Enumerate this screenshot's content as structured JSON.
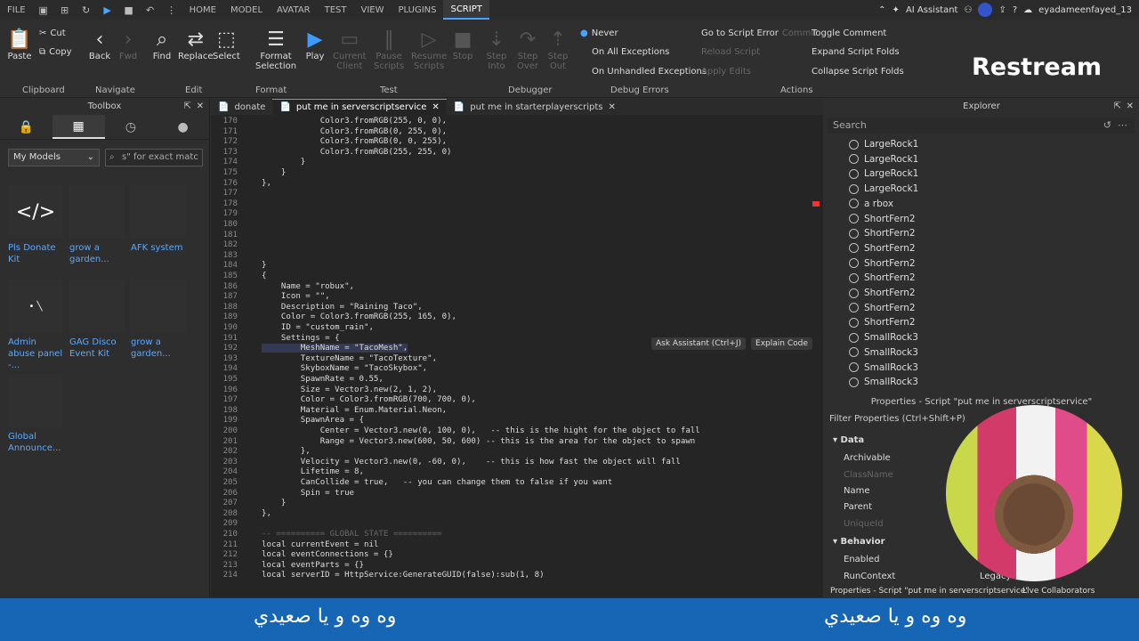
{
  "menu": {
    "file": "FILE",
    "home": "HOME",
    "model": "MODEL",
    "avatar": "AVATAR",
    "test": "TEST",
    "view": "VIEW",
    "plugins": "PLUGINS",
    "script": "SCRIPT",
    "assistant": "AI Assistant",
    "user": "eyadameenfayed_13"
  },
  "ribbon": {
    "cut": "Cut",
    "copy": "Copy",
    "paste": "Paste",
    "back": "Back",
    "fwd": "Fwd",
    "find": "Find",
    "replace": "Replace",
    "select": "Select",
    "format": "Format",
    "selection": "Selection",
    "play": "Play",
    "current": "Current",
    "client": "Client",
    "pause": "Pause",
    "scripts": "Scripts",
    "resume": "Resume",
    "scripts2": "Scripts",
    "stop": "Stop",
    "stepinto1": "Step",
    "stepinto2": "Into",
    "stepover1": "Step",
    "stepover2": "Over",
    "stepout1": "Step",
    "stepout2": "Out",
    "never": "Never",
    "allexc": "On All Exceptions",
    "unhandled": "On Unhandled Exceptions",
    "goto": "Go to Script Error",
    "commit": "Commit",
    "reload": "Reload Script",
    "apply": "Apply Edits",
    "toggle": "Toggle Comment",
    "expand": "Expand Script Folds",
    "collapse": "Collapse Script Folds",
    "g_clip": "Clipboard",
    "g_nav": "Navigate",
    "g_edit": "Edit",
    "g_format": "Format",
    "g_test": "Test",
    "g_debug": "Debugger",
    "g_errors": "Debug Errors",
    "g_actions": "Actions"
  },
  "brand": "Restream",
  "toolbox": {
    "title": "Toolbox",
    "dropdown": "My Models",
    "search": "s\" for exact matc",
    "items": [
      "Pls Donate Kit",
      "grow a garden...",
      "AFK system",
      "Admin abuse panel -...",
      "GAG Disco Event Kit",
      "grow a garden...",
      "Global Announce..."
    ]
  },
  "tabs": [
    "donate",
    "put me in serverscriptservice",
    "put me in starterplayerscripts"
  ],
  "code": [
    [
      "170",
      "            Color3.fromRGB(255, 0, 0),"
    ],
    [
      "171",
      "            Color3.fromRGB(0, 255, 0),"
    ],
    [
      "172",
      "            Color3.fromRGB(0, 0, 255),"
    ],
    [
      "173",
      "            Color3.fromRGB(255, 255, 0)"
    ],
    [
      "174",
      "        }"
    ],
    [
      "175",
      "    }"
    ],
    [
      "176",
      "},"
    ],
    [
      "177",
      ""
    ],
    [
      "178",
      ""
    ],
    [
      "179",
      ""
    ],
    [
      "180",
      ""
    ],
    [
      "181",
      ""
    ],
    [
      "182",
      ""
    ],
    [
      "183",
      ""
    ],
    [
      "184",
      "}"
    ],
    [
      "185",
      "{"
    ],
    [
      "186",
      "    Name = \"robux\","
    ],
    [
      "187",
      "    Icon = \"\","
    ],
    [
      "188",
      "    Description = \"Raining Taco\","
    ],
    [
      "189",
      "    Color = Color3.fromRGB(255, 165, 0),"
    ],
    [
      "190",
      "    ID = \"custom_rain\","
    ],
    [
      "191",
      "    Settings = {"
    ],
    [
      "192",
      "        MeshName = \"TacoMesh\","
    ],
    [
      "193",
      "        TextureName = \"TacoTexture\","
    ],
    [
      "194",
      "        SkyboxName = \"TacoSkybox\","
    ],
    [
      "195",
      "        SpawnRate = 0.55,"
    ],
    [
      "196",
      "        Size = Vector3.new(2, 1, 2),"
    ],
    [
      "197",
      "        Color = Color3.fromRGB(700, 700, 0),"
    ],
    [
      "198",
      "        Material = Enum.Material.Neon,"
    ],
    [
      "199",
      "        SpawnArea = {"
    ],
    [
      "200",
      "            Center = Vector3.new(0, 100, 0),   -- this is the hight for the object to fall"
    ],
    [
      "201",
      "            Range = Vector3.new(600, 50, 600) -- this is the area for the object to spawn"
    ],
    [
      "202",
      "        },"
    ],
    [
      "203",
      "        Velocity = Vector3.new(0, -60, 0),    -- this is how fast the object will fall"
    ],
    [
      "204",
      "        Lifetime = 8,"
    ],
    [
      "205",
      "        CanCollide = true,   -- you can change them to false if you want"
    ],
    [
      "206",
      "        Spin = true"
    ],
    [
      "207",
      "    }"
    ],
    [
      "208",
      "},"
    ],
    [
      "209",
      ""
    ],
    [
      "210",
      "-- ========== GLOBAL STATE =========="
    ],
    [
      "211",
      "local currentEvent = nil"
    ],
    [
      "212",
      "local eventConnections = {}"
    ],
    [
      "213",
      "local eventParts = {}"
    ],
    [
      "214",
      "local serverID = HttpService:GenerateGUID(false):sub(1, 8)"
    ]
  ],
  "tooltip": {
    "ask": "Ask Assistant (Ctrl+J)",
    "explain": "Explain Code"
  },
  "explorer": {
    "title": "Explorer",
    "search": "Search",
    "rows": [
      "LargeRock1",
      "LargeRock1",
      "LargeRock1",
      "LargeRock1",
      "a rbox",
      "ShortFern2",
      "ShortFern2",
      "ShortFern2",
      "ShortFern2",
      "ShortFern2",
      "ShortFern2",
      "ShortFern2",
      "ShortFern2",
      "SmallRock3",
      "SmallRock3",
      "SmallRock3",
      "SmallRock3"
    ]
  },
  "properties": {
    "title": "Properties - Script \"put me in serverscriptservice\"",
    "filter": "Filter Properties (Ctrl+Shift+P)",
    "data": "Data",
    "archivable": "Archivable",
    "classname": "ClassName",
    "name": "Name",
    "parent": "Parent",
    "uniqueid": "UniqueId",
    "behavior": "Behavior",
    "enabled": "Enabled",
    "runcontext": "RunContext",
    "legacy": "Legacy"
  },
  "status": {
    "props": "Properties - Script \"put me in serverscriptservice\"",
    "live": "Live Collaborators"
  },
  "subtitle": "وه وه و يا صعيدي"
}
